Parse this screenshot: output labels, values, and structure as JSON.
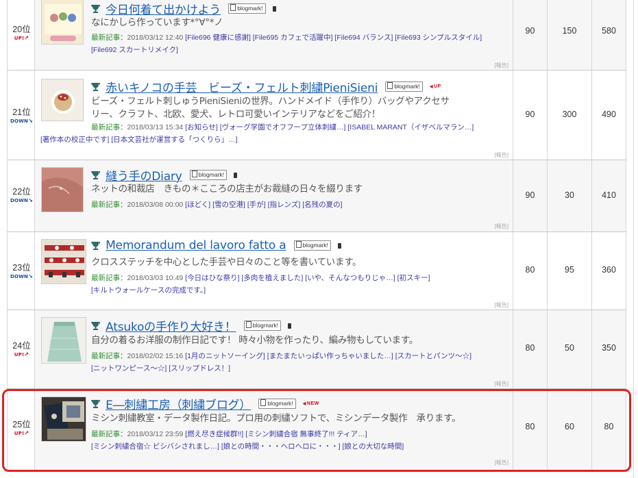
{
  "rows": [
    {
      "rank": "20位",
      "trend": "UP!",
      "trend_dir": "up",
      "title": "今日何着て出かけよう",
      "badge": "blogmark!",
      "status": "",
      "desc": [
        "なにかしら作っています*°∀°*ノ"
      ],
      "latest_label": "最新記事：",
      "latest_date": "2018/03/12 12:40",
      "entries_line1": [
        "[File696 健康に感謝]",
        "[File695 カフェで活躍中]",
        "[File694 バランス]",
        "[File693 シンプルスタイル]"
      ],
      "entries_line2": [
        "[File692 スカートリメイク]"
      ],
      "report": "[報告]",
      "stats": [
        "90",
        "150",
        "580"
      ]
    },
    {
      "rank": "21位",
      "trend": "DOWN",
      "trend_dir": "down",
      "title": "赤いキノコの手芸　ビーズ・フェルト刺繍PieniSieni",
      "badge": "blogmark!",
      "status": "UP",
      "desc": [
        "ビーズ・フェルト刺しゅうPieniSieniの世界。ハンドメイド（手作り）バッグやアクセサ",
        "リー、クラフト、北欧、愛犬、レトロ可愛いインテリアなどをご紹介！"
      ],
      "latest_label": "最新記事：",
      "latest_date": "2018/03/13 15:34",
      "entries_line1": [
        "[お知らせ]",
        "[ヴォーグ学園でオフフープ立体刺繍…]",
        "[ISABEL MARANT（イザベルマラン…]"
      ],
      "entries_line2": [
        "[著作本の校正中です]",
        "[日本文芸社が運営する「つくりら」…]"
      ],
      "report": "[報告]",
      "stats": [
        "90",
        "300",
        "490"
      ]
    },
    {
      "rank": "22位",
      "trend": "DOWN",
      "trend_dir": "down",
      "title": "縫う手のDiary",
      "badge": "blogmark!",
      "status": "",
      "desc": [
        "ネットの和裁店　きもの＊こころの店主がお裁縫の日々を綴ります"
      ],
      "latest_label": "最新記事：",
      "latest_date": "2018/03/08 00:00",
      "entries_line1": [
        "[ほどく]",
        "[雪の空港]",
        "[手が]",
        "[指レンズ]",
        "[名残の夏の]"
      ],
      "entries_line2": [],
      "report": "[報告]",
      "stats": [
        "90",
        "30",
        "410"
      ]
    },
    {
      "rank": "23位",
      "trend": "DOWN",
      "trend_dir": "down",
      "title": "Memorandum del lavoro fatto a",
      "badge": "blogmark!",
      "status": "",
      "desc": [
        "クロスステッチを中心とした手芸や日々のこと等を書いています。"
      ],
      "latest_label": "最新記事：",
      "latest_date": "2018/03/03 10:49",
      "entries_line1": [
        "[今日はひな祭り]",
        "[多肉を植えました]",
        "[いや、そんなつもりじゃ…]",
        "[初スキー]"
      ],
      "entries_line2": [
        "[キルトウォールケースの完成です。]"
      ],
      "report": "[報告]",
      "stats": [
        "80",
        "95",
        "360"
      ]
    },
    {
      "rank": "24位",
      "trend": "UP!",
      "trend_dir": "up",
      "title": "Atsukoの手作り大好き！",
      "badge": "blogmark!",
      "status": "",
      "desc": [
        "自分の着るお洋服の制作日記です！ 時々小物を作ったり、編み物もしています。"
      ],
      "latest_label": "最新記事：",
      "latest_date": "2018/02/02 15:16",
      "entries_line1": [
        "[1月のニットソーイング]",
        "[またまたいっぱい作っちゃいました…]",
        "[スカートとパンツ〜☆]"
      ],
      "entries_line2": [
        "[ニットワンピース〜☆]",
        "[スリップドレス！]"
      ],
      "report": "[報告]",
      "stats": [
        "80",
        "50",
        "350"
      ]
    },
    {
      "rank": "25位",
      "trend": "UP!",
      "trend_dir": "up",
      "title": "E―刺繍工房（刺繍ブログ）",
      "badge": "blogmark!",
      "status": "NEW",
      "desc": [
        "ミシン刺繍教室・データ製作日記。プロ用の刺繍ソフトで、ミシンデータ製作　承ります。"
      ],
      "latest_label": "最新記事：",
      "latest_date": "2018/03/12 23:59",
      "entries_line1": [
        "[燃え尽き症候群!!]",
        "[ミシン刺繍合宿 無事終了!!! ティア…]"
      ],
      "entries_line2": [
        "[ミシン刺繍合宿☆ ビシバシされまし…]",
        "[娘との時間・・・ヘロヘロに・・・]",
        "[娘との大切な時間]"
      ],
      "report": "[報告]",
      "stats": [
        "80",
        "60",
        "80"
      ]
    }
  ],
  "colors": {
    "link": "#1a5fb4",
    "label_green": "#2e8b2e",
    "entry_link": "#3a3aa8",
    "up_red": "#d0021b",
    "down_blue": "#1a4a9a",
    "highlight": "#e02020"
  },
  "icons": {
    "trophy": "trophy-icon",
    "mobile": "mobile-icon",
    "blogmark": "blogmark-icon"
  }
}
